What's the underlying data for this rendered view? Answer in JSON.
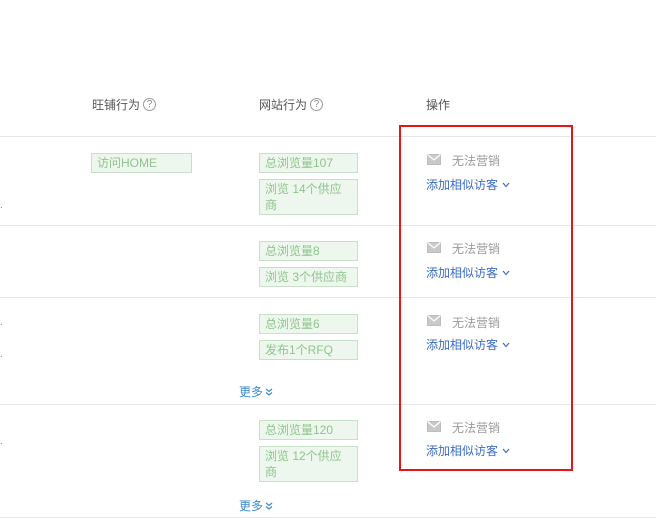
{
  "header": {
    "wangpu_label": "旺铺行为",
    "website_label": "网站行为",
    "action_label": "操作",
    "help_glyph": "?"
  },
  "rows": [
    {
      "wangpu_tags": [
        "访问HOME"
      ],
      "website_tags": [
        "总浏览量107",
        "浏览 14个供应商"
      ],
      "action": {
        "status": "无法营销",
        "add_similar": "添加相似访客"
      }
    },
    {
      "wangpu_tags": [],
      "website_tags": [
        "总浏览量8",
        "浏览 3个供应商"
      ],
      "action": {
        "status": "无法营销",
        "add_similar": "添加相似访客"
      }
    },
    {
      "wangpu_tags": [],
      "website_tags": [
        "总浏览量6",
        "发布1个RFQ"
      ],
      "more": "更多",
      "action": {
        "status": "无法营销",
        "add_similar": "添加相似访客"
      }
    },
    {
      "wangpu_tags": [],
      "website_tags": [
        "总浏览量120",
        "浏览 12个供应商"
      ],
      "more": "更多",
      "action": {
        "status": "无法营销",
        "add_similar": "添加相似访客"
      }
    }
  ],
  "icons": {
    "help": "question-circle-icon",
    "mail": "mail-icon",
    "chevron": "chevron-down-icon",
    "double_chevron": "double-chevron-down-icon"
  },
  "colors": {
    "tag_border": "#c8e0c8",
    "tag_bg": "#eef7ee",
    "tag_text": "#8ec48e",
    "link": "#3b6cc7",
    "highlight_box": "#e8141b"
  }
}
